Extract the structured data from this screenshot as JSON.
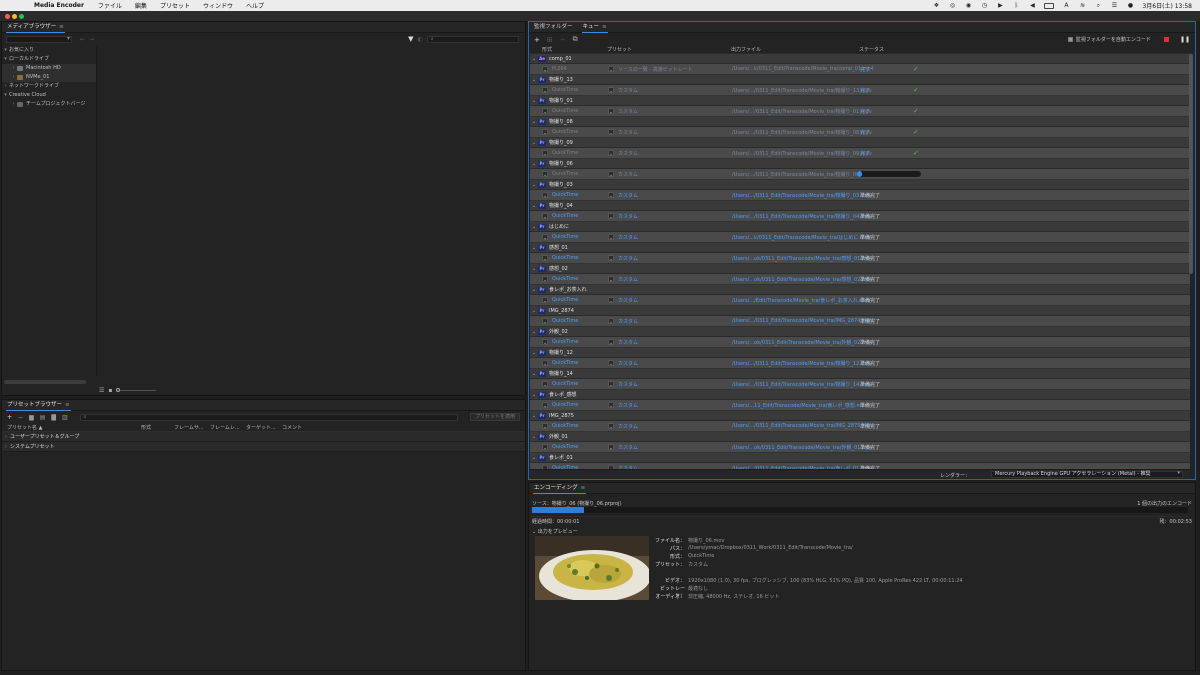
{
  "menubar": {
    "app_name": "Media Encoder",
    "menus": [
      "ファイル",
      "編集",
      "プリセット",
      "ウィンドウ",
      "ヘルプ"
    ],
    "clock": "3月6日(土) 13:58"
  },
  "media_browser": {
    "tab_label": "メディアブラウザー",
    "tree": [
      {
        "label": "お気に入り",
        "level": 0,
        "chevron": "▾"
      },
      {
        "label": "ローカルドライブ",
        "level": 0,
        "chevron": "▾"
      },
      {
        "label": "Macintosh HD",
        "level": 1,
        "chevron": "›",
        "icon": "drive"
      },
      {
        "label": "NVMe_01",
        "level": 1,
        "chevron": "›",
        "icon": "drive"
      },
      {
        "label": "ネットワークドライブ",
        "level": 0,
        "chevron": "›"
      },
      {
        "label": "Creative Cloud",
        "level": 0,
        "chevron": "▾"
      },
      {
        "label": "チームプロジェクトバージ",
        "level": 1,
        "chevron": "›",
        "icon": "folder"
      }
    ]
  },
  "preset_browser": {
    "tab_label": "プリセットブラウザー",
    "apply_button": "プリセットを適用",
    "columns": [
      "プリセット名 ▲",
      "形式",
      "フレームサ...",
      "フレームレ...",
      "ターゲット...",
      "コメント"
    ],
    "rows": [
      "ユーザープリセット＆グループ",
      "システムプリセット"
    ]
  },
  "queue": {
    "tab_watch": "監視フォルダー",
    "tab_queue": "キュー",
    "auto_encode_label": "監視フォルダーを自動エンコード",
    "columns": [
      "形式",
      "プリセット",
      "出力ファイル",
      "ステータス"
    ],
    "groups": [
      {
        "name": "comp_01",
        "badge": "Ae",
        "format": "H.264",
        "preset": "ソースの一致 - 高速ビットレート",
        "output": "/Users/...k/0311_Edit/Transcode/Movie_tra/comp_01.mp4",
        "status": "完了",
        "state": "done"
      },
      {
        "name": "物撮り_13",
        "badge": "Pr",
        "format": "QuickTime",
        "preset": "カスタム",
        "output": "/Users/.../0311_Edit/Transcode/Movie_tra/物撮り_13.mov",
        "status": "完了",
        "state": "done"
      },
      {
        "name": "物撮り_01",
        "badge": "Pr",
        "format": "QuickTime",
        "preset": "カスタム",
        "output": "/Users/.../0311_Edit/Transcode/Movie_tra/物撮り_01.mov",
        "status": "完了",
        "state": "done"
      },
      {
        "name": "物撮り_08",
        "badge": "Pr",
        "format": "QuickTime",
        "preset": "カスタム",
        "output": "/Users/.../0311_Edit/Transcode/Movie_tra/物撮り_08.mov",
        "status": "完了",
        "state": "done"
      },
      {
        "name": "物撮り_09",
        "badge": "Pr",
        "format": "QuickTime",
        "preset": "カスタム",
        "output": "/Users/.../0311_Edit/Transcode/Movie_tra/物撮り_09.mov",
        "status": "完了",
        "state": "done"
      },
      {
        "name": "物撮り_06",
        "badge": "Pr",
        "format": "QuickTime",
        "preset": "カスタム",
        "output": "/Users/.../0311_Edit/Transcode/Movie_tra/物撮り_06.mov",
        "status": "",
        "state": "encoding",
        "progress": 0.08
      },
      {
        "name": "物撮り_03",
        "badge": "Pr",
        "format": "QuickTime",
        "preset": "カスタム",
        "output": "/Users/.../0311_Edit/Transcode/Movie_tra/物撮り_03.mov",
        "status": "準備完了",
        "state": "ready"
      },
      {
        "name": "物撮り_04",
        "badge": "Pr",
        "format": "QuickTime",
        "preset": "カスタム",
        "output": "/Users/.../0311_Edit/Transcode/Movie_tra/物撮り_04.mov",
        "status": "準備完了",
        "state": "ready"
      },
      {
        "name": "はじめに",
        "badge": "Pr",
        "format": "QuickTime",
        "preset": "カスタム",
        "output": "/Users/...k/0311_Edit/Transcode/Movie_tra/はじめに.mov",
        "status": "準備完了",
        "state": "ready"
      },
      {
        "name": "感想_01",
        "badge": "Pr",
        "format": "QuickTime",
        "preset": "カスタム",
        "output": "/Users/...ok/0311_Edit/Transcode/Movie_tra/感想_01.mov",
        "status": "準備完了",
        "state": "ready"
      },
      {
        "name": "感想_02",
        "badge": "Pr",
        "format": "QuickTime",
        "preset": "カスタム",
        "output": "/Users/...ok/0311_Edit/Transcode/Movie_tra/感想_02.mov",
        "status": "準備完了",
        "state": "ready"
      },
      {
        "name": "食レポ_お茶入れ",
        "badge": "Pr",
        "format": "QuickTime",
        "preset": "カスタム",
        "output": "/Users/.../Edit/Transcode/Movie_tra/食レポ_お茶入れ.mov",
        "status": "準備完了",
        "state": "ready"
      },
      {
        "name": "IMG_2874",
        "badge": "Pr",
        "format": "QuickTime",
        "preset": "カスタム",
        "output": "/Users/.../0311_Edit/Transcode/Movie_tra/IMG_2874.MOV",
        "status": "準備完了",
        "state": "ready"
      },
      {
        "name": "外観_02",
        "badge": "Pr",
        "format": "QuickTime",
        "preset": "カスタム",
        "output": "/Users/...ok/0311_Edit/Transcode/Movie_tra/外観_02.mov",
        "status": "準備完了",
        "state": "ready"
      },
      {
        "name": "物撮り_12",
        "badge": "Pr",
        "format": "QuickTime",
        "preset": "カスタム",
        "output": "/Users/.../0311_Edit/Transcode/Movie_tra/物撮り_12.mov",
        "status": "準備完了",
        "state": "ready"
      },
      {
        "name": "物撮り_14",
        "badge": "Pr",
        "format": "QuickTime",
        "preset": "カスタム",
        "output": "/Users/.../0311_Edit/Transcode/Movie_tra/物撮り_14.mov",
        "status": "準備完了",
        "state": "ready"
      },
      {
        "name": "食レポ_感想",
        "badge": "Pr",
        "format": "QuickTime",
        "preset": "カスタム",
        "output": "/Users/...11_Edit/Transcode/Movie_tra/食レポ_感想.mov",
        "status": "準備完了",
        "state": "ready"
      },
      {
        "name": "IMG_2875",
        "badge": "Pr",
        "format": "QuickTime",
        "preset": "カスタム",
        "output": "/Users/.../0311_Edit/Transcode/Movie_tra/IMG_2875.MOV",
        "status": "準備完了",
        "state": "ready"
      },
      {
        "name": "外観_01",
        "badge": "Pr",
        "format": "QuickTime",
        "preset": "カスタム",
        "output": "/Users/...ok/0311_Edit/Transcode/Movie_tra/外観_01.mov",
        "status": "準備完了",
        "state": "ready"
      },
      {
        "name": "食レポ_01",
        "badge": "Pr",
        "format": "QuickTime",
        "preset": "カスタム",
        "output": "/Users/.../0311_Edit/Transcode/Movie_tra/食レポ_01.mov",
        "status": "準備完了",
        "state": "ready"
      }
    ],
    "renderer_label": "レンダラー：",
    "renderer_value": "Mercury Playback Engine GPU アクセラレーション (Metal) - 推奨"
  },
  "encoding": {
    "tab_label": "エンコーディング",
    "source": "ソース：物撮り_06 (物撮り_06.prproj)",
    "outputs_count": "1 個の出力のエンコード",
    "progress": 0.08,
    "elapsed": "経過時間：00:00:01",
    "remaining": "残：00:02:53",
    "preview_label": "出力をプレビュー",
    "info": [
      {
        "k": "ファイル名：",
        "v": "物撮り_06.mov"
      },
      {
        "k": "パス：",
        "v": "/Users/ymac/Dropbox/0311_Work/0311_Edit/Transcode/Movie_tra/"
      },
      {
        "k": "形式：",
        "v": "QuickTime"
      },
      {
        "k": "プリセット：",
        "v": "カスタム"
      },
      {
        "k": "",
        "v": ""
      },
      {
        "k": "ビデオ：",
        "v": "1920x1080 (1.0), 30 fps, プログレッシブ, 100 (83% HLG, 51% PQ), 品質 100, Apple ProRes 422 LT, 00:00:11:24"
      },
      {
        "k": "ビットレート：",
        "v": "最適なし"
      },
      {
        "k": "オーディオ：",
        "v": "非圧縮, 48000 Hz, ステレオ, 16 ビット"
      }
    ]
  }
}
